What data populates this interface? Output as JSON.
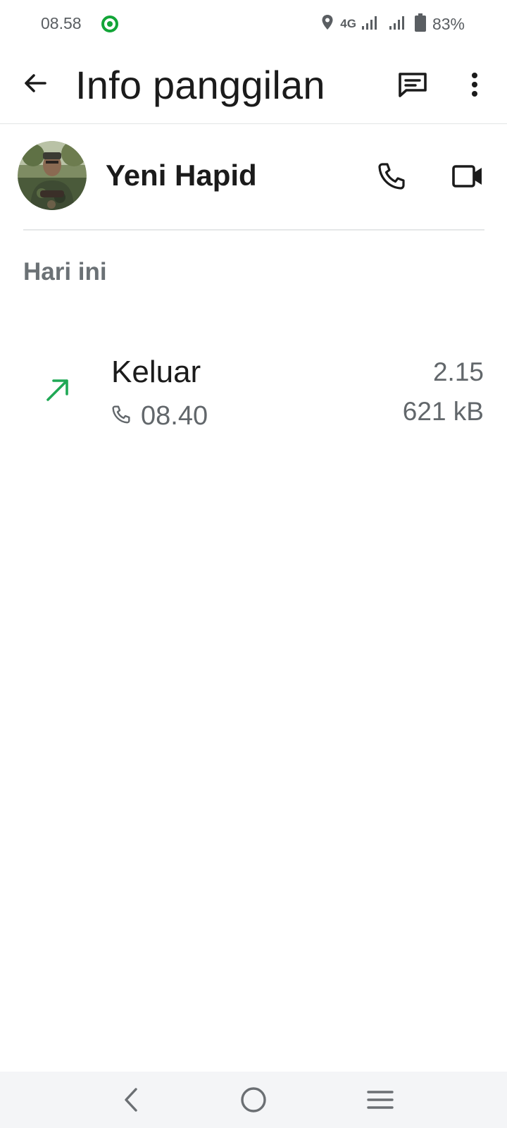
{
  "status_bar": {
    "time": "08.58",
    "network": "4G",
    "battery": "83%",
    "icons": [
      "app-notification-icon",
      "location-icon",
      "signal-icon",
      "signal-icon",
      "battery-icon"
    ]
  },
  "app_bar": {
    "title": "Info panggilan",
    "icons": [
      "back-arrow-icon",
      "message-icon",
      "more-vert-icon"
    ]
  },
  "contact": {
    "name": "Yeni Hapid",
    "icons": [
      "avatar",
      "phone-icon",
      "video-icon"
    ]
  },
  "section": {
    "label": "Hari ini"
  },
  "calls": [
    {
      "type": "Keluar",
      "time": "08.40",
      "duration": "2.15",
      "size": "621 kB",
      "direction_icon": "outgoing-arrow-icon",
      "call_kind_icon": "phone-icon"
    }
  ],
  "nav_bar": {
    "icons": [
      "nav-back-icon",
      "nav-home-icon",
      "nav-recents-icon"
    ]
  },
  "colors": {
    "accent_green": "#1fa855",
    "status_app_green": "#13a538",
    "text_primary": "#1b1b1b",
    "text_secondary": "#62676b"
  }
}
